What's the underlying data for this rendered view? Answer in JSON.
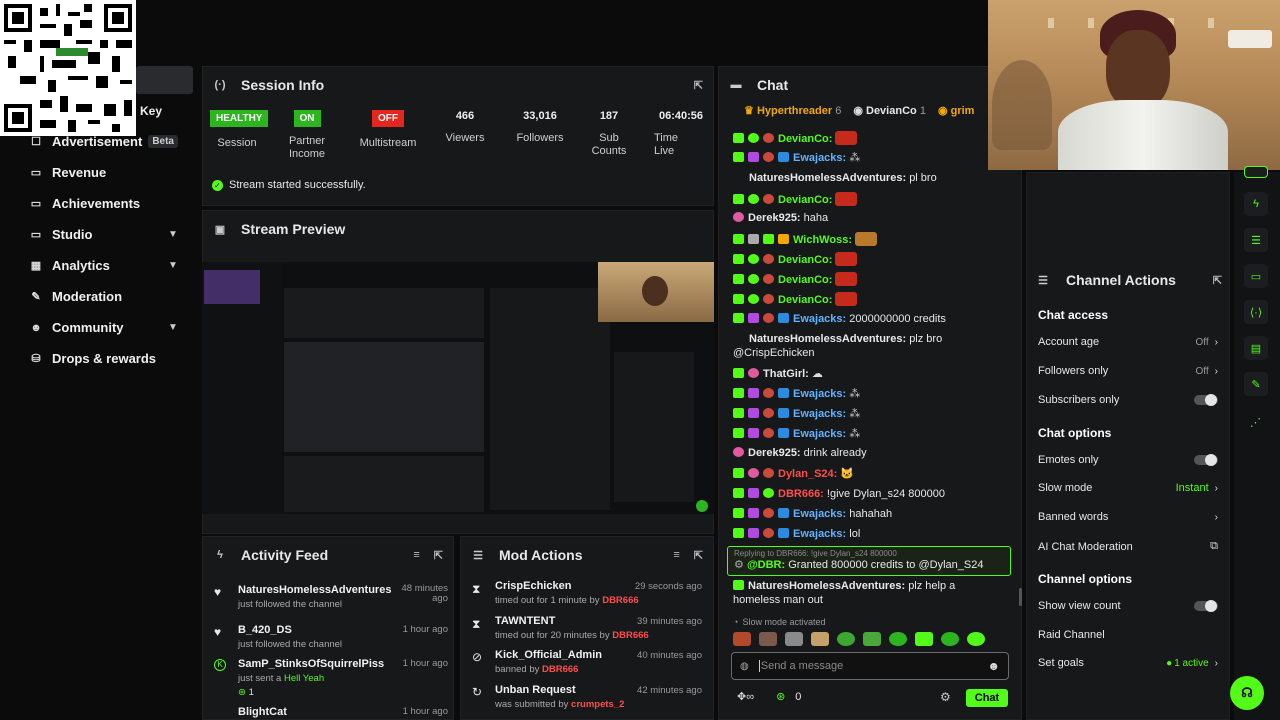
{
  "sidebar": {
    "top_label": "Key",
    "items": [
      {
        "label": "Advertisement",
        "badge": "Beta"
      },
      {
        "label": "Revenue"
      },
      {
        "label": "Achievements"
      },
      {
        "label": "Studio"
      },
      {
        "label": "Analytics"
      },
      {
        "label": "Moderation"
      },
      {
        "label": "Community"
      },
      {
        "label": "Drops & rewards"
      }
    ]
  },
  "session": {
    "title": "Session Info",
    "stats": [
      {
        "value": "HEALTHY",
        "label": "Session"
      },
      {
        "value": "ON",
        "label": "Partner Income"
      },
      {
        "value": "OFF",
        "label": "Multistream"
      },
      {
        "value": "466",
        "label": "Viewers"
      },
      {
        "value": "33,016",
        "label": "Followers"
      },
      {
        "value": "187",
        "label": "Sub Counts"
      },
      {
        "value": "06:40:56",
        "label": "Time Live"
      }
    ],
    "notice": "Stream started successfully."
  },
  "preview": {
    "title": "Stream Preview"
  },
  "activity": {
    "title": "Activity Feed",
    "items": [
      {
        "name": "NaturesHomelessAdventures",
        "sub": "just followed the channel",
        "time": "48 minutes ago"
      },
      {
        "name": "B_420_DS",
        "sub": "just followed the channel",
        "time": "1 hour ago"
      },
      {
        "name": "SamP_StinksOfSquirrelPiss",
        "sub": "just sent a",
        "sub_hl": "Hell Yeah",
        "count": "1",
        "time": "1 hour ago"
      },
      {
        "name": "BlightCat",
        "sub": "",
        "time": "1 hour ago"
      }
    ]
  },
  "mod": {
    "title": "Mod Actions",
    "items": [
      {
        "name": "CrispEchicken",
        "sub": "timed out for 1 minute by",
        "by": "DBR666",
        "time": "29 seconds ago"
      },
      {
        "name": "TAWNTENT",
        "sub": "timed out for 20 minutes by",
        "by": "DBR666",
        "time": "39 minutes ago"
      },
      {
        "name": "Kick_Official_Admin",
        "sub": "banned by",
        "by": "DBR666",
        "time": "40 minutes ago"
      },
      {
        "name": "Unban Request",
        "sub": "was submitted by",
        "by": "crumpets_2",
        "time": "42 minutes ago"
      }
    ]
  },
  "chat": {
    "title": "Chat",
    "pinned": [
      {
        "name": "Hyperthreader",
        "count": "6"
      },
      {
        "name": "DevianCo",
        "count": "1"
      },
      {
        "name": "grim",
        "count": ""
      }
    ],
    "messages": [
      {
        "user": "DevianCo:",
        "color": "#53fc18",
        "text": ""
      },
      {
        "user": "Ewajacks:",
        "color": "#5fb3ff",
        "text": ""
      },
      {
        "user": "NaturesHomelessAdventures:",
        "color": "#ffffff",
        "text": "pl bro"
      },
      {
        "user": "DevianCo:",
        "color": "#53fc18",
        "text": ""
      },
      {
        "user": "Derek925:",
        "color": "#ffffff",
        "text": "haha"
      },
      {
        "user": "WichWoss:",
        "color": "#53fc18",
        "text": ""
      },
      {
        "user": "DevianCo:",
        "color": "#53fc18",
        "text": ""
      },
      {
        "user": "DevianCo:",
        "color": "#53fc18",
        "text": ""
      },
      {
        "user": "DevianCo:",
        "color": "#53fc18",
        "text": ""
      },
      {
        "user": "Ewajacks:",
        "color": "#5fb3ff",
        "text": "2000000000 credits"
      },
      {
        "user": "NaturesHomelessAdventures:",
        "color": "#ffffff",
        "text": "plz bro"
      },
      {
        "user": "ThatGirl:",
        "color": "#ffffff",
        "text": ""
      },
      {
        "user": "Ewajacks:",
        "color": "#5fb3ff",
        "text": ""
      },
      {
        "user": "Ewajacks:",
        "color": "#5fb3ff",
        "text": ""
      },
      {
        "user": "Ewajacks:",
        "color": "#5fb3ff",
        "text": ""
      },
      {
        "user": "Derek925:",
        "color": "#ffffff",
        "text": "drink already"
      },
      {
        "user": "Dylan_S24:",
        "color": "#ff4d4d",
        "text": ""
      },
      {
        "user": "DBR666:",
        "color": "#ff4d4d",
        "text": "!give Dylan_s24 800000"
      },
      {
        "user": "Ewajacks:",
        "color": "#5fb3ff",
        "text": "hahahah"
      },
      {
        "user": "Ewajacks:",
        "color": "#5fb3ff",
        "text": "lol"
      }
    ],
    "wrap_line": "@CrispEchicken",
    "reply_context": "Replying to DBR666: !give Dylan_s24 800000",
    "reply_user": "@DBR:",
    "reply_text": "Granted 800000 credits to @Dylan_S24",
    "last_user": "NaturesHomelessAdventures:",
    "last_text": "plz help a",
    "last_wrap": "homeless man out",
    "slow_mode": "Slow mode activated",
    "input_placeholder": "Send a message",
    "count": "0",
    "send_label": "Chat"
  },
  "channel": {
    "title": "Channel Actions",
    "chat_access": "Chat access",
    "account_age": {
      "label": "Account age",
      "value": "Off"
    },
    "followers_only": {
      "label": "Followers only",
      "value": "Off"
    },
    "subscribers_only": "Subscribers only",
    "chat_options": "Chat options",
    "emotes_only": "Emotes only",
    "slow_mode": {
      "label": "Slow mode",
      "value": "Instant"
    },
    "banned_words": "Banned words",
    "ai_moderation": "AI Chat Moderation",
    "channel_options": "Channel options",
    "show_view_count": "Show view count",
    "raid_channel": "Raid Channel",
    "set_goals": {
      "label": "Set goals",
      "value": "1 active"
    }
  },
  "colors": {
    "accent": "#53fc18",
    "danger": "#e5261c",
    "panel": "#17181a"
  }
}
